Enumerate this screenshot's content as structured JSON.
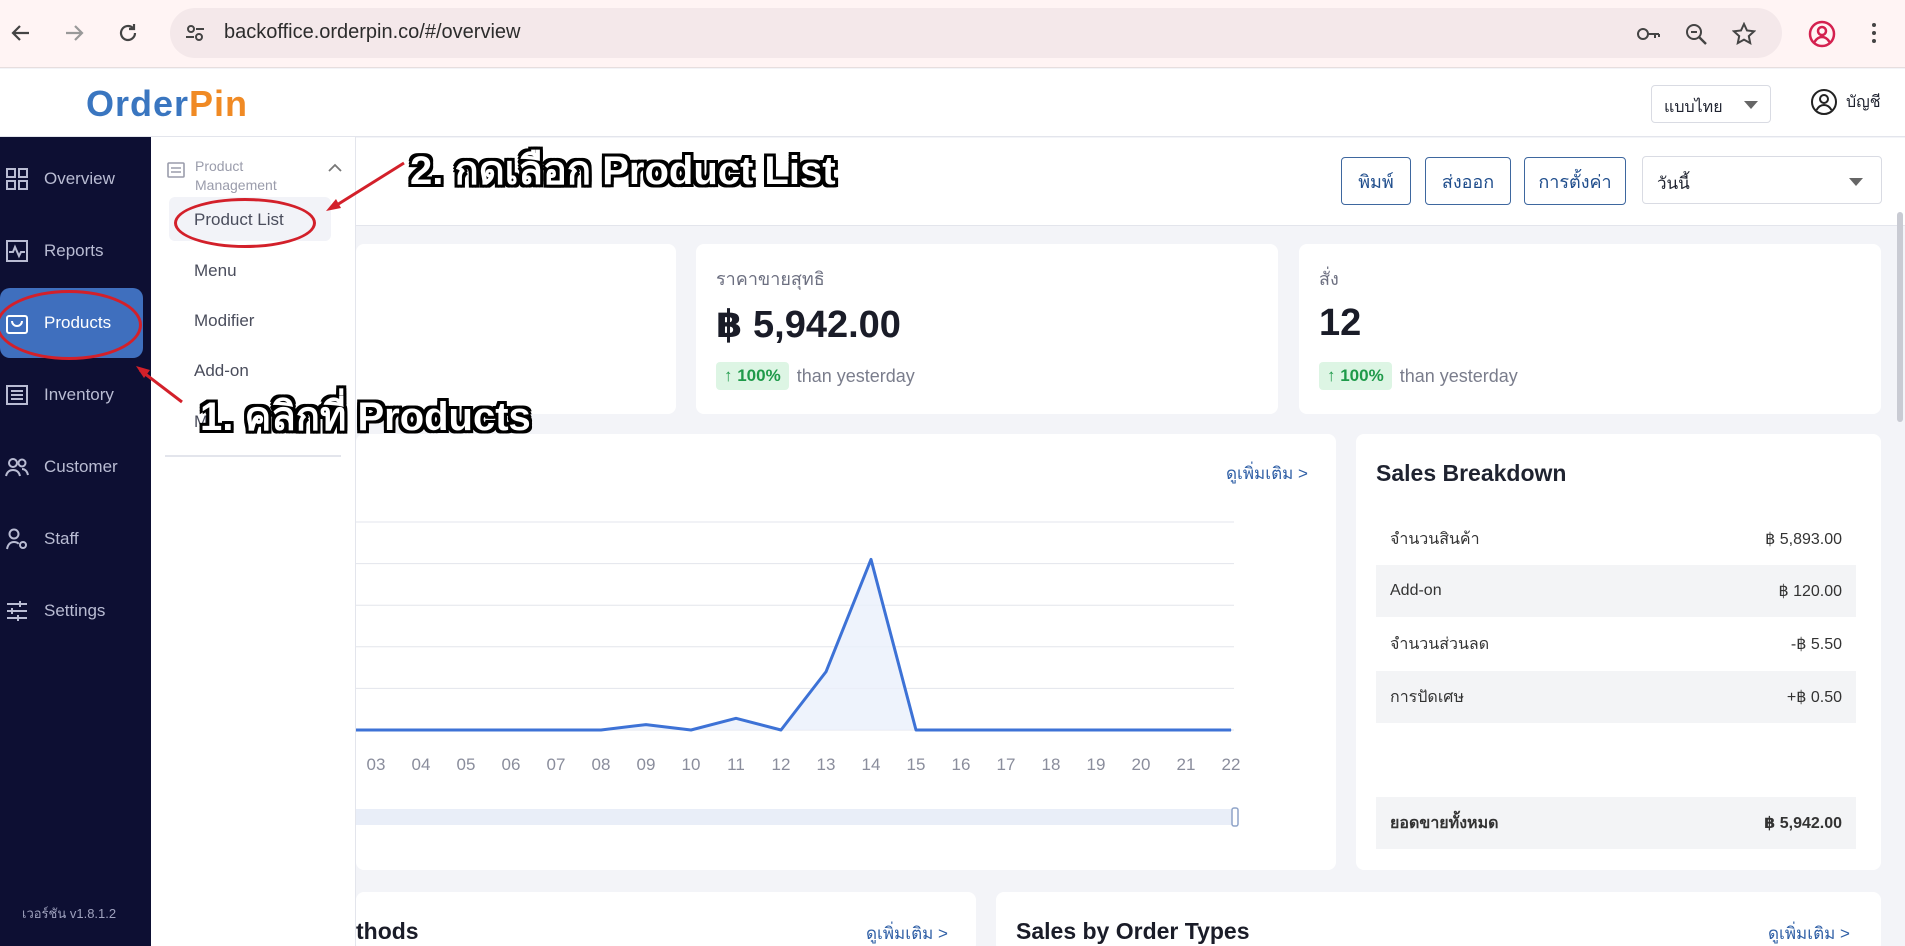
{
  "browser": {
    "url": "backoffice.orderpin.co/#/overview"
  },
  "header": {
    "logo_left": "Order",
    "logo_right": "Pin",
    "language": "แบบไทย",
    "account_label": "บัญชี"
  },
  "sidebar": {
    "items": [
      {
        "label": "Overview",
        "icon": "grid-icon"
      },
      {
        "label": "Reports",
        "icon": "activity-icon"
      },
      {
        "label": "Products",
        "icon": "bag-icon",
        "active": true
      },
      {
        "label": "Inventory",
        "icon": "inventory-icon"
      },
      {
        "label": "Customer",
        "icon": "users-icon"
      },
      {
        "label": "Staff",
        "icon": "staff-icon"
      },
      {
        "label": "Settings",
        "icon": "sliders-icon"
      }
    ],
    "version": "เวอร์ชัน v1.8.1.2"
  },
  "submenu": {
    "group_title": "Product Management",
    "items": [
      "Product List",
      "Menu",
      "Modifier",
      "Add-on",
      "Me"
    ]
  },
  "toolbar": {
    "print": "พิมพ์",
    "export": "ส่งออก",
    "settings": "การตั้งค่า",
    "date_range": "วันนี้"
  },
  "stats": [
    {
      "label": "ราคาขายสุทธิ",
      "value": "฿ 5,942.00",
      "delta": "↑ 100%",
      "compare": "than yesterday"
    },
    {
      "label": "สั่ง",
      "value": "12",
      "delta": "↑ 100%",
      "compare": "than yesterday"
    }
  ],
  "chart": {
    "more_link": "ดูเพิ่มเติม >",
    "line_color": "#3d72d6"
  },
  "chart_data": {
    "type": "line",
    "x": [
      "03",
      "04",
      "05",
      "06",
      "07",
      "08",
      "09",
      "10",
      "11",
      "12",
      "13",
      "14",
      "15",
      "16",
      "17",
      "18",
      "19",
      "20",
      "21",
      "22"
    ],
    "series": [
      {
        "values": [
          0,
          0,
          0,
          0,
          0,
          0,
          130,
          0,
          280,
          0,
          1400,
          4100,
          0,
          0,
          0,
          0,
          0,
          0,
          0,
          0
        ]
      }
    ],
    "ylim": [
      0,
      5000
    ],
    "grid": true
  },
  "sales_breakdown": {
    "title": "Sales Breakdown",
    "rows": [
      {
        "label": "จำนวนสินค้า",
        "value": "฿ 5,893.00"
      },
      {
        "label": "Add-on",
        "value": "฿ 120.00"
      },
      {
        "label": "จำนวนส่วนลด",
        "value": "-฿ 5.50"
      },
      {
        "label": "การปัดเศษ",
        "value": "+฿ 0.50"
      }
    ],
    "total_label": "ยอดขายทั้งหมด",
    "total_value": "฿ 5,942.00"
  },
  "bottom": {
    "left_title": "thods",
    "left_more": "ดูเพิ่มเติม >",
    "right_title": "Sales by Order Types",
    "right_more": "ดูเพิ่มเติม >"
  },
  "annotations": {
    "step1": "1. คลิกที่ Products",
    "step2": "2. กดเลือก Product List",
    "color": "#d3202a"
  }
}
